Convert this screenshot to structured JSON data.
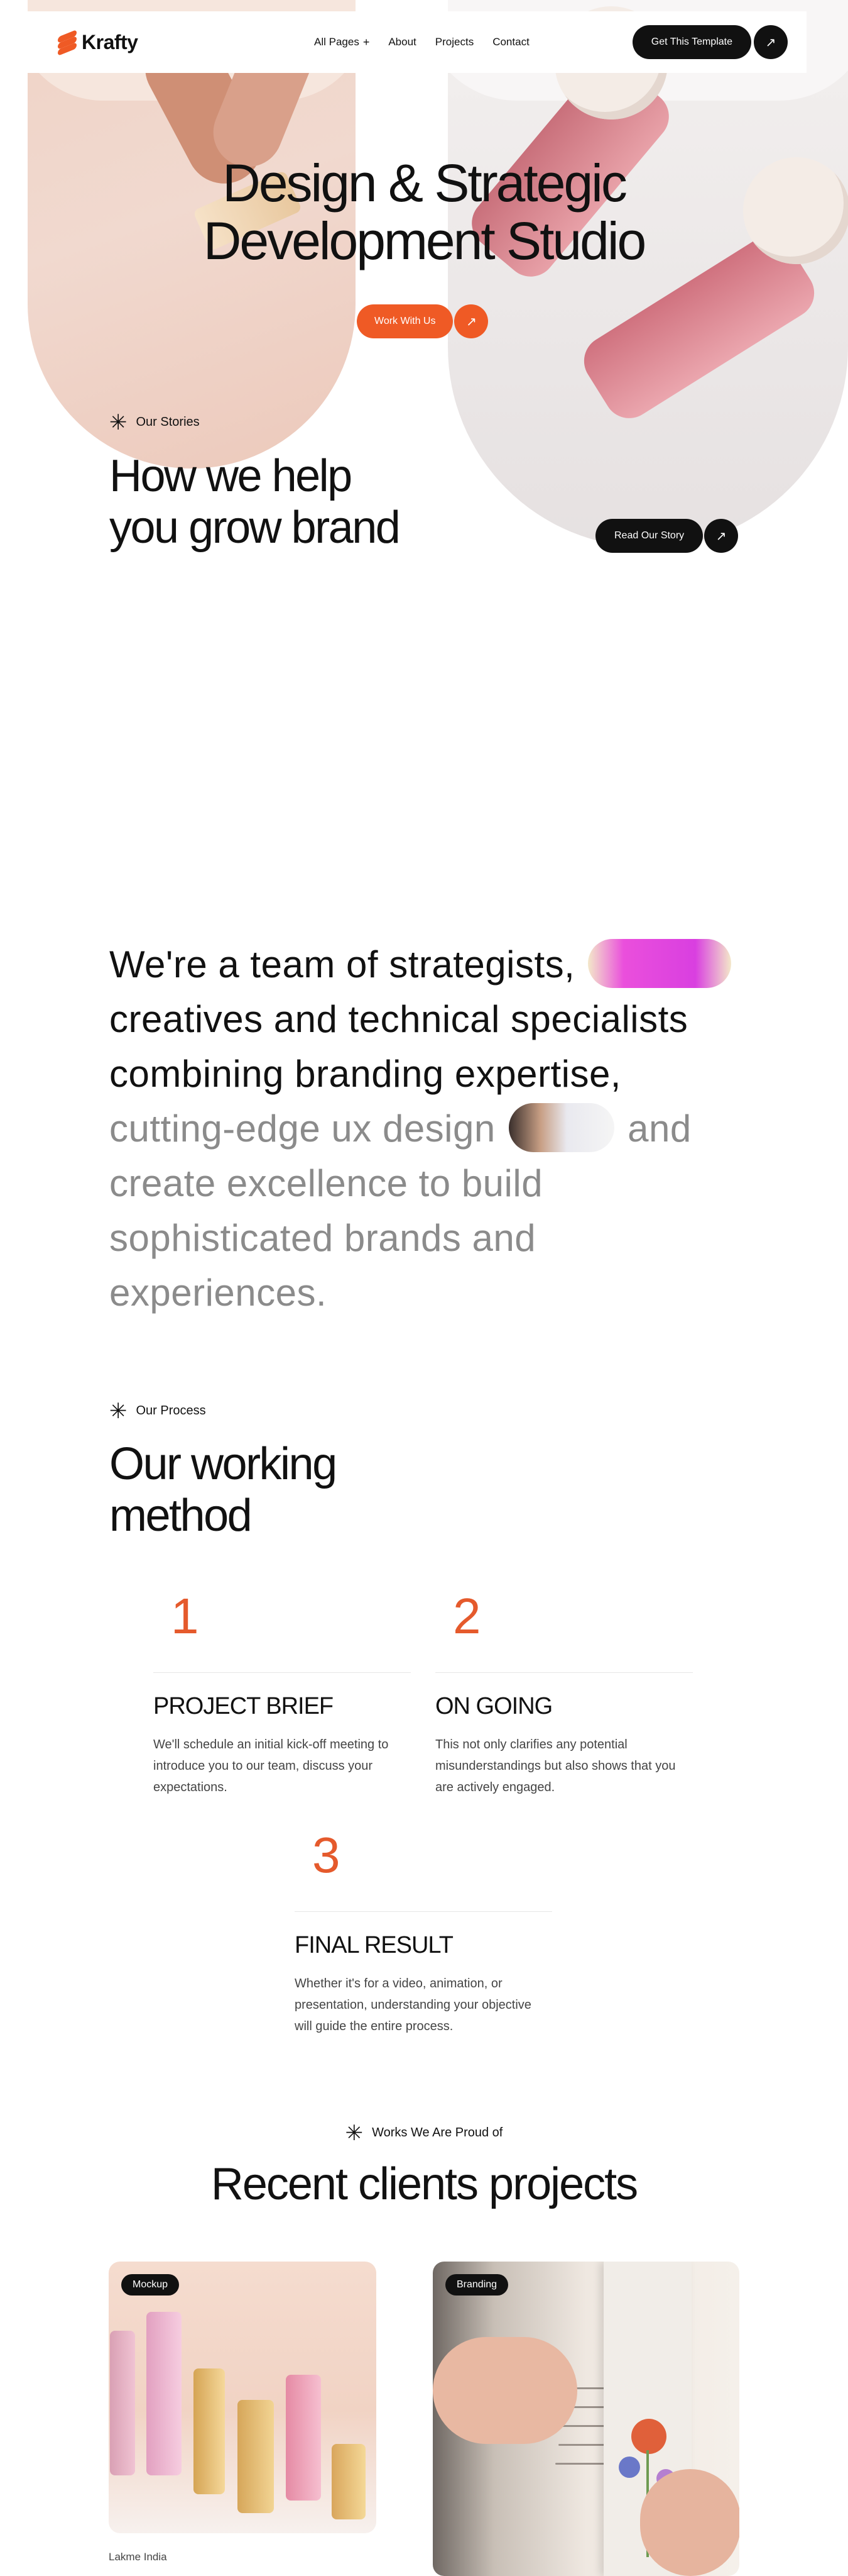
{
  "nav": {
    "brand": "Krafty",
    "links": [
      "All Pages",
      "About",
      "Projects",
      "Contact"
    ],
    "all_pages_icon": "plus-icon",
    "cta_label": "Get This Template",
    "cta_icon": "arrow-up-right-icon"
  },
  "hero": {
    "title_line1": "Design & Strategic",
    "title_line2": "Development Studio",
    "cta_label": "Work With Us",
    "cta_icon": "arrow-up-right-icon"
  },
  "stories": {
    "eyebrow": "Our Stories",
    "title_line1": "How we help",
    "title_line2": "you grow brand",
    "cta_label": "Read Our Story"
  },
  "statement": {
    "part1": "We're a team of strategists,",
    "part2": "creatives and technical specialists combining branding expertise,",
    "part3": "cutting-edge ux design",
    "part4": "and create excellence to build sophisticated brands and experiences."
  },
  "process": {
    "eyebrow": "Our Process",
    "title_line1": "Our working",
    "title_line2": "method",
    "steps": [
      {
        "num": "1",
        "title": "PROJECT BRIEF",
        "desc": "We'll schedule an initial kick-off meeting to introduce you to our team, discuss your expectations."
      },
      {
        "num": "2",
        "title": "ON GOING",
        "desc": "This not only clarifies any potential misunderstandings but also shows that you are actively engaged."
      },
      {
        "num": "3",
        "title": "FINAL RESULT",
        "desc": "Whether it's for a video, animation, or presentation, understanding your objective will guide the entire process."
      }
    ]
  },
  "works": {
    "eyebrow": "Works We Are Proud of",
    "title": "Recent clients projects",
    "projects": [
      {
        "tag": "Mockup",
        "caption": "Lakme India"
      },
      {
        "tag": "Branding",
        "caption": ""
      }
    ]
  },
  "colors": {
    "accent": "#ef5a25",
    "dark": "#111111",
    "muted_text": "#8b8b8b",
    "step_number": "#e55a2c"
  }
}
